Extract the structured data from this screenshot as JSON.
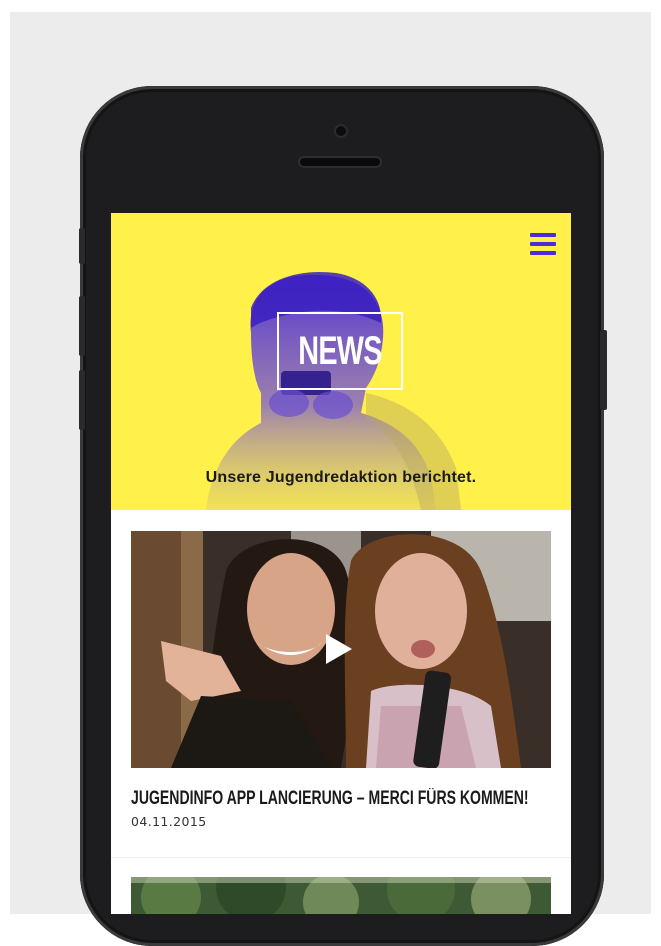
{
  "header": {
    "menu_icon": "hamburger-menu-icon",
    "hero_title": "NEWS",
    "tagline": "Unsere Jugendredaktion berichtet."
  },
  "articles": [
    {
      "title": "JUGENDINFO APP LANCIERUNG – MERCI FÜRS KOMMEN!",
      "date": "04.11.2015",
      "media_icon": "play-icon"
    }
  ],
  "colors": {
    "accent_yellow": "#fff04a",
    "accent_purple": "#4a2cd8",
    "phone_body": "#1d1d1f"
  }
}
